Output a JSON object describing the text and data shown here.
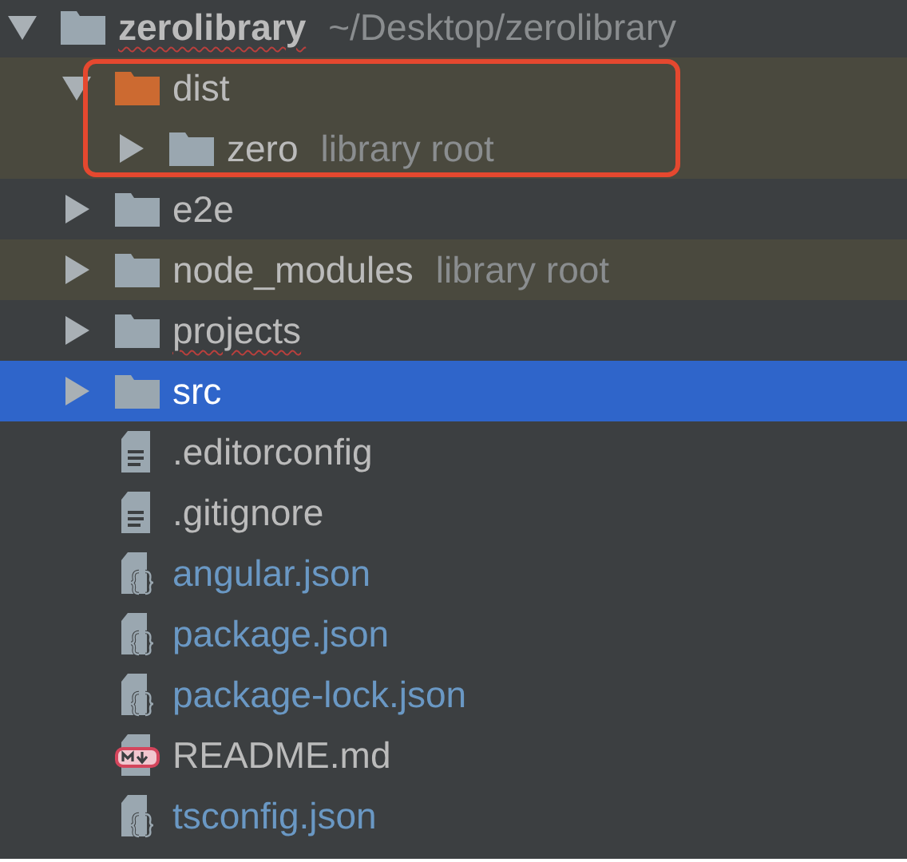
{
  "tree": [
    {
      "name": "zerolibrary",
      "detail": "~/Desktop/zerolibrary",
      "kind": "folder",
      "expanded": true,
      "selected": false,
      "misspelled": true,
      "children": [
        {
          "name": "dist",
          "kind": "excluded-folder",
          "expanded": true,
          "selected": false,
          "shaded": true,
          "outlined": true,
          "children": [
            {
              "name": "zero",
              "detail": "library root",
              "kind": "folder",
              "expanded": false,
              "selected": false,
              "shaded": true
            }
          ]
        },
        {
          "name": "e2e",
          "kind": "folder",
          "expanded": false,
          "selected": false
        },
        {
          "name": "node_modules",
          "detail": "library root",
          "kind": "folder",
          "expanded": false,
          "selected": false,
          "shaded": true
        },
        {
          "name": "projects",
          "kind": "folder",
          "expanded": false,
          "selected": false,
          "misspelled": true
        },
        {
          "name": "src",
          "kind": "folder",
          "expanded": false,
          "selected": true
        },
        {
          "name": ".editorconfig",
          "kind": "text-file",
          "selected": false
        },
        {
          "name": ".gitignore",
          "kind": "text-file",
          "selected": false
        },
        {
          "name": "angular.json",
          "kind": "json-file",
          "selected": false,
          "modified": true
        },
        {
          "name": "package.json",
          "kind": "json-file",
          "selected": false,
          "modified": true
        },
        {
          "name": "package-lock.json",
          "kind": "json-file",
          "selected": false,
          "modified": true
        },
        {
          "name": "README.md",
          "kind": "markdown-file",
          "selected": false
        },
        {
          "name": "tsconfig.json",
          "kind": "json-file",
          "selected": false,
          "modified": true
        }
      ]
    }
  ]
}
